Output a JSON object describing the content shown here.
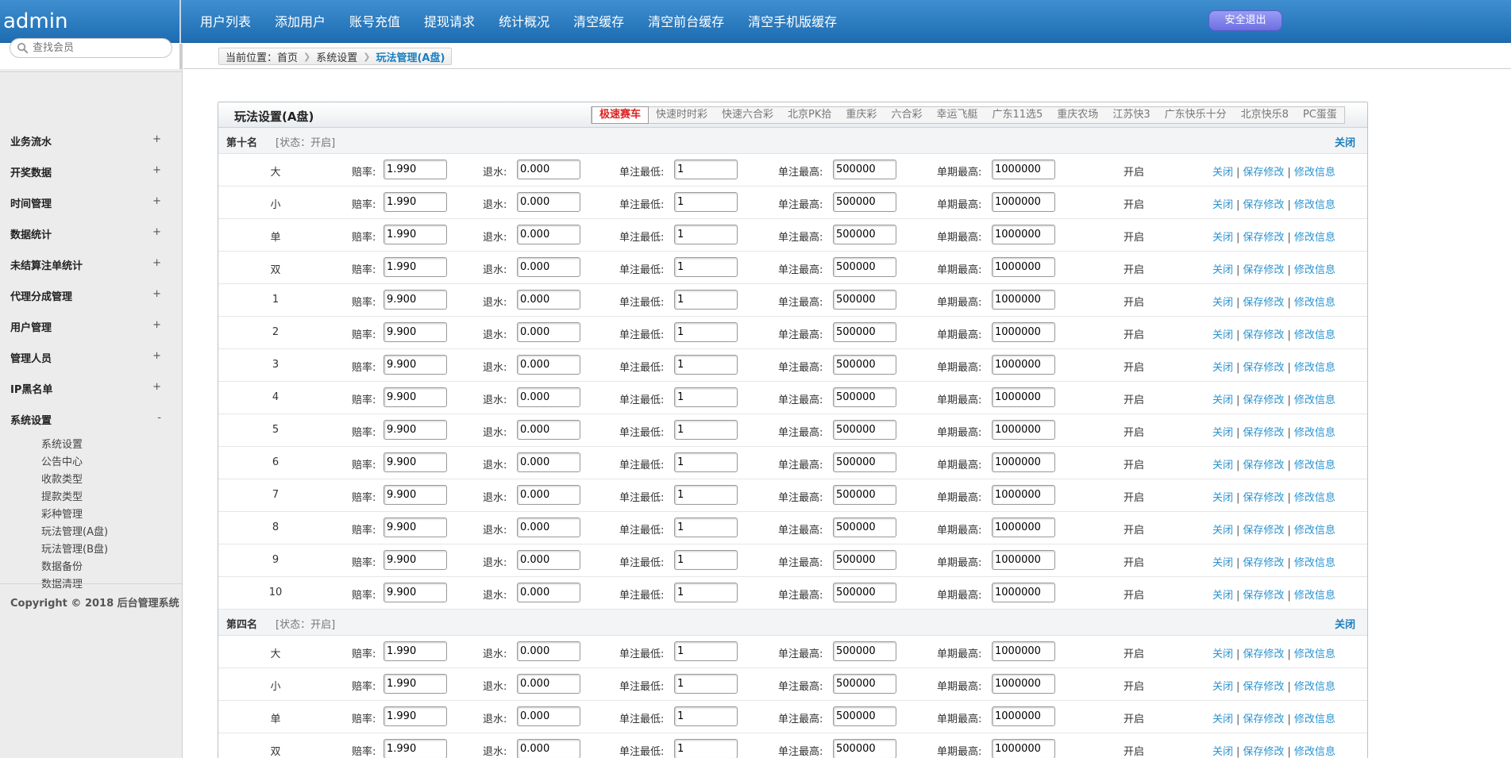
{
  "header": {
    "logo": "admin",
    "nav": [
      "用户列表",
      "添加用户",
      "账号充值",
      "提现请求",
      "统计概况",
      "清空缓存",
      "清空前台缓存",
      "清空手机版缓存"
    ],
    "logout_label": "安全退出"
  },
  "sidebar": {
    "search_placeholder": "查找会员",
    "menu": [
      {
        "label": "业务流水",
        "sign": "+"
      },
      {
        "label": "开奖数据",
        "sign": "+"
      },
      {
        "label": "时间管理",
        "sign": "+"
      },
      {
        "label": "数据统计",
        "sign": "+"
      },
      {
        "label": "未结算注单统计",
        "sign": "+"
      },
      {
        "label": "代理分成管理",
        "sign": "+"
      },
      {
        "label": "用户管理",
        "sign": "+"
      },
      {
        "label": "管理人员",
        "sign": "+"
      },
      {
        "label": "IP黑名单",
        "sign": "+"
      },
      {
        "label": "系统设置",
        "sign": "-"
      }
    ],
    "submenu": [
      "系统设置",
      "公告中心",
      "收款类型",
      "提款类型",
      "彩种管理",
      "玩法管理(A盘)",
      "玩法管理(B盘)",
      "数据备份",
      "数据清理"
    ],
    "copyright": "Copyright © 2018 后台管理系统"
  },
  "breadcrumb": {
    "prefix": "当前位置：",
    "items": [
      "首页",
      "系统设置",
      "玩法管理(A盘)"
    ]
  },
  "panel": {
    "title": "玩法设置(A盘)",
    "tabs": [
      "极速赛车",
      "快速时时彩",
      "快速六合彩",
      "北京PK拾",
      "重庆彩",
      "六合彩",
      "幸运飞艇",
      "广东11选5",
      "重庆农场",
      "江苏快3",
      "广东快乐十分",
      "北京快乐8",
      "PC蛋蛋"
    ],
    "active_tab": 0,
    "labels": {
      "odds": "赔率:",
      "rebate": "退水:",
      "min_bet": "单注最低:",
      "max_bet": "单注最高:",
      "max_period": "单期最高:"
    },
    "actions": {
      "close": "关闭",
      "save": "保存修改",
      "edit": "修改信息",
      "sep": "|"
    },
    "sections": [
      {
        "name": "第十名",
        "status": "[状态：开启]",
        "toggle": "关闭",
        "rows": [
          {
            "name": "大",
            "odds": "1.990",
            "rebate": "0.000",
            "min": "1",
            "max": "500000",
            "period_max": "1000000",
            "state": "开启"
          },
          {
            "name": "小",
            "odds": "1.990",
            "rebate": "0.000",
            "min": "1",
            "max": "500000",
            "period_max": "1000000",
            "state": "开启"
          },
          {
            "name": "单",
            "odds": "1.990",
            "rebate": "0.000",
            "min": "1",
            "max": "500000",
            "period_max": "1000000",
            "state": "开启"
          },
          {
            "name": "双",
            "odds": "1.990",
            "rebate": "0.000",
            "min": "1",
            "max": "500000",
            "period_max": "1000000",
            "state": "开启"
          },
          {
            "name": "1",
            "odds": "9.900",
            "rebate": "0.000",
            "min": "1",
            "max": "500000",
            "period_max": "1000000",
            "state": "开启"
          },
          {
            "name": "2",
            "odds": "9.900",
            "rebate": "0.000",
            "min": "1",
            "max": "500000",
            "period_max": "1000000",
            "state": "开启"
          },
          {
            "name": "3",
            "odds": "9.900",
            "rebate": "0.000",
            "min": "1",
            "max": "500000",
            "period_max": "1000000",
            "state": "开启"
          },
          {
            "name": "4",
            "odds": "9.900",
            "rebate": "0.000",
            "min": "1",
            "max": "500000",
            "period_max": "1000000",
            "state": "开启"
          },
          {
            "name": "5",
            "odds": "9.900",
            "rebate": "0.000",
            "min": "1",
            "max": "500000",
            "period_max": "1000000",
            "state": "开启"
          },
          {
            "name": "6",
            "odds": "9.900",
            "rebate": "0.000",
            "min": "1",
            "max": "500000",
            "period_max": "1000000",
            "state": "开启"
          },
          {
            "name": "7",
            "odds": "9.900",
            "rebate": "0.000",
            "min": "1",
            "max": "500000",
            "period_max": "1000000",
            "state": "开启"
          },
          {
            "name": "8",
            "odds": "9.900",
            "rebate": "0.000",
            "min": "1",
            "max": "500000",
            "period_max": "1000000",
            "state": "开启"
          },
          {
            "name": "9",
            "odds": "9.900",
            "rebate": "0.000",
            "min": "1",
            "max": "500000",
            "period_max": "1000000",
            "state": "开启"
          },
          {
            "name": "10",
            "odds": "9.900",
            "rebate": "0.000",
            "min": "1",
            "max": "500000",
            "period_max": "1000000",
            "state": "开启"
          }
        ]
      },
      {
        "name": "第四名",
        "status": "[状态：开启]",
        "toggle": "关闭",
        "rows": [
          {
            "name": "大",
            "odds": "1.990",
            "rebate": "0.000",
            "min": "1",
            "max": "500000",
            "period_max": "1000000",
            "state": "开启"
          },
          {
            "name": "小",
            "odds": "1.990",
            "rebate": "0.000",
            "min": "1",
            "max": "500000",
            "period_max": "1000000",
            "state": "开启"
          },
          {
            "name": "单",
            "odds": "1.990",
            "rebate": "0.000",
            "min": "1",
            "max": "500000",
            "period_max": "1000000",
            "state": "开启"
          },
          {
            "name": "双",
            "odds": "1.990",
            "rebate": "0.000",
            "min": "1",
            "max": "500000",
            "period_max": "1000000",
            "state": "开启"
          }
        ]
      }
    ]
  }
}
